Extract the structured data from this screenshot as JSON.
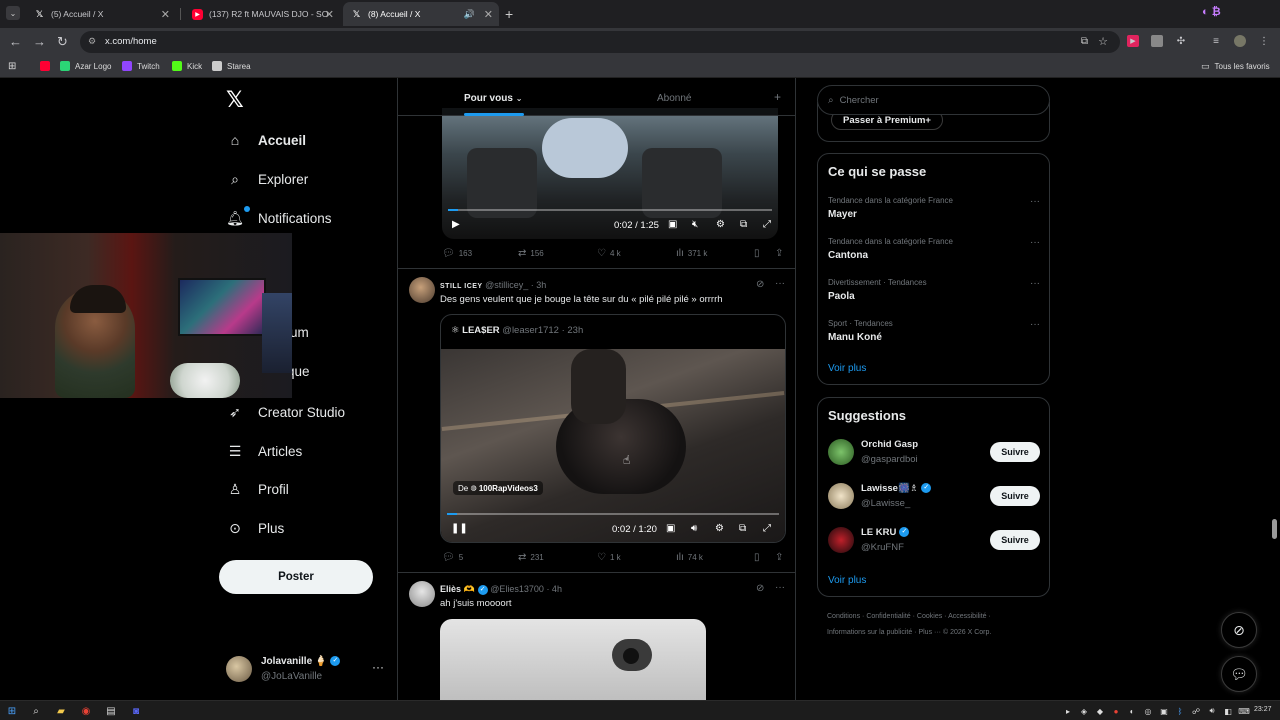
{
  "browser": {
    "tabs": [
      {
        "title": "(5) Accueil / X",
        "icon": "x-logo-icon"
      },
      {
        "title": "(137) R2 ft MAUVAIS DJO - SO",
        "icon": "youtube-icon"
      },
      {
        "title": "(8) Accueil / X",
        "icon": "x-logo-icon"
      }
    ],
    "url": "x.com/home",
    "bookmarks": [
      {
        "label": "Azar Logo",
        "color": "#2bd576"
      },
      {
        "label": "Twitch",
        "color": "#9146ff"
      },
      {
        "label": "Kick",
        "color": "#53fc18"
      },
      {
        "label": "Starea",
        "color": "#cccccc"
      }
    ],
    "all_bookmarks": "Tous les favoris"
  },
  "nav": {
    "items": [
      {
        "label": "Accueil",
        "icon": "home-icon"
      },
      {
        "label": "Explorer",
        "icon": "search-icon"
      },
      {
        "label": "Notifications",
        "icon": "bell-icon"
      },
      {
        "label": "um",
        "icon": ""
      },
      {
        "label": "ique",
        "icon": ""
      },
      {
        "label": "Creator Studio",
        "icon": "rocket-icon"
      },
      {
        "label": "Articles",
        "icon": "article-icon"
      },
      {
        "label": "Profil",
        "icon": "person-icon"
      },
      {
        "label": "Plus",
        "icon": "more-circle-icon"
      }
    ],
    "post_button": "Poster",
    "account": {
      "name": "Jolavanille 🍦",
      "handle": "@JoLaVanille"
    }
  },
  "feed": {
    "tabs": [
      "Pour vous",
      "Abonné"
    ],
    "tweet1": {
      "video_time": "0:02 / 1:25",
      "video_progress": 0.03,
      "replies": "163",
      "reposts": "156",
      "likes": "4 k",
      "views": "371 k"
    },
    "tweet2": {
      "author": "STILL ICEY",
      "handle": "@stillicey_",
      "time": "· 3h",
      "text": "Des gens veulent que je bouge la tête sur du «  pilé pilé pilé » orrrrh",
      "quote": {
        "author": "LEA$ER",
        "handle": "@leaser1712",
        "time": "· 23h",
        "source_prefix": "De",
        "source": "100RapVideos3",
        "video_time": "0:02 / 1:20",
        "video_progress": 0.03
      },
      "replies": "5",
      "reposts": "231",
      "likes": "1 k",
      "views": "74 k"
    },
    "tweet3": {
      "author": "Eliès 🫶",
      "handle": "@Elies13700",
      "time": "· 4h",
      "text": "ah j'suis moooort"
    }
  },
  "sidebar": {
    "search_placeholder": "Chercher",
    "premium_button": "Passer à Premium+",
    "trends_title": "Ce qui se passe",
    "trends": [
      {
        "category": "Tendance dans la catégorie France",
        "name": "Mayer"
      },
      {
        "category": "Tendance dans la catégorie France",
        "name": "Cantona"
      },
      {
        "category": "Divertissement · Tendances",
        "name": "Paola"
      },
      {
        "category": "Sport · Tendances",
        "name": "Manu Koné"
      }
    ],
    "see_more": "Voir plus",
    "suggestions_title": "Suggestions",
    "suggestions": [
      {
        "name": "Orchid Gasp",
        "handle": "@gaspardboi",
        "verified": false,
        "button": "Suivre"
      },
      {
        "name": "Lawisse🎆♗",
        "handle": "@Lawisse_",
        "verified": true,
        "button": "Suivre"
      },
      {
        "name": "LE KRU",
        "handle": "@KruFNF",
        "verified": true,
        "button": "Suivre"
      }
    ],
    "footer": {
      "links": [
        "Conditions",
        "Confidentialité",
        "Cookies",
        "Accessibilité",
        "Informations sur la publicité",
        "Plus ···"
      ],
      "copyright": "© 2026 X Corp."
    }
  },
  "taskbar": {
    "time": "23:27"
  },
  "colors": {
    "accent": "#1d9bf0",
    "background": "#000000",
    "muted": "#71767b"
  }
}
